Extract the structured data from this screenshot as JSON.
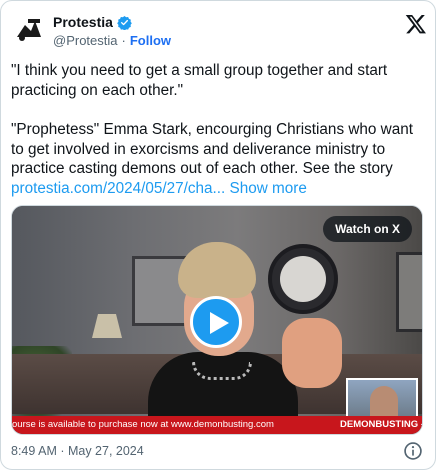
{
  "tweet": {
    "display_name": "Protestia",
    "handle": "@Protestia",
    "separator": "·",
    "follow_label": "Follow",
    "paragraphs": [
      "\"I think you need to get a small group together and start practicing on each other.\"",
      "\"Prophetess\" Emma Stark, encourging Christians who want to get involved in exorcisms and deliverance ministry to practice casting demons out of each other. See the story"
    ],
    "link_text": "protestia.com/2024/05/27/cha...",
    "show_more_label": "Show more",
    "timestamp": "8:49 AM · May 27, 2024"
  },
  "media": {
    "watch_label": "Watch on X",
    "ticker_left": "ourse is available to purchase now at www.demonbusting.com",
    "ticker_right": "DEMONBUSTING - Er"
  },
  "colors": {
    "accent": "#1d9bf0",
    "follow": "#1d6ff2",
    "verified": "#1d9bf0",
    "ticker": "#c8161c"
  },
  "icons": {
    "verified": "verified-badge-icon",
    "x_logo": "x-logo-icon",
    "play": "play-icon",
    "info": "info-icon"
  }
}
